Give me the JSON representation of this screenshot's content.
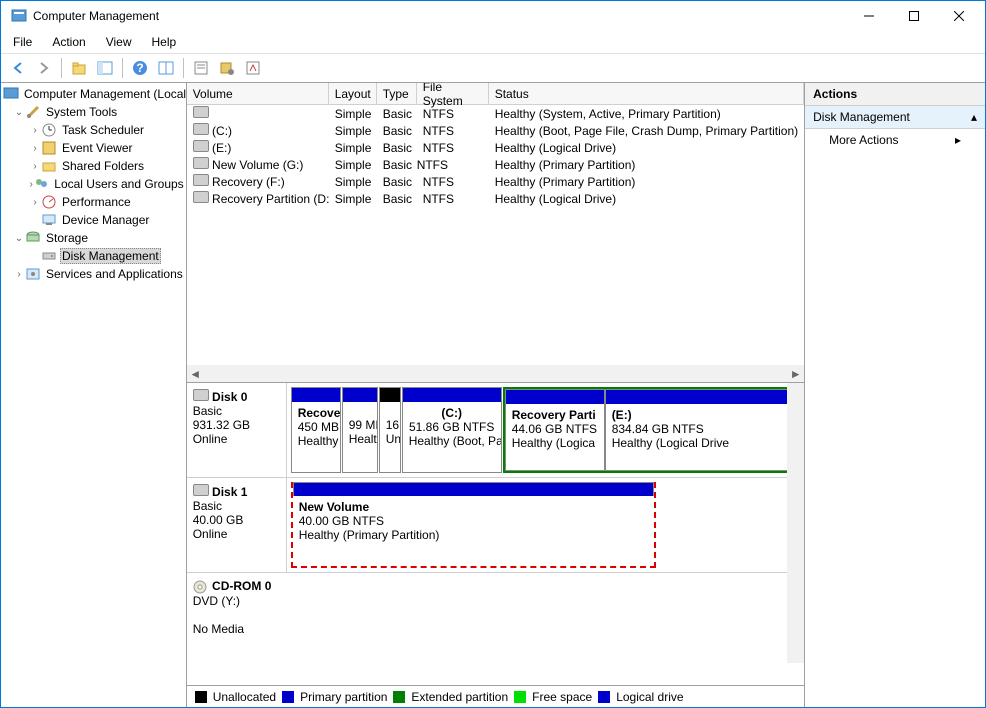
{
  "window": {
    "title": "Computer Management"
  },
  "menu": {
    "file": "File",
    "action": "Action",
    "view": "View",
    "help": "Help"
  },
  "tree": {
    "root": "Computer Management (Local",
    "systemTools": "System Tools",
    "taskScheduler": "Task Scheduler",
    "eventViewer": "Event Viewer",
    "sharedFolders": "Shared Folders",
    "localUsers": "Local Users and Groups",
    "performance": "Performance",
    "deviceManager": "Device Manager",
    "storage": "Storage",
    "diskManagement": "Disk Management",
    "services": "Services and Applications"
  },
  "columns": {
    "volume": "Volume",
    "layout": "Layout",
    "type": "Type",
    "fs": "File System",
    "status": "Status"
  },
  "volumes": [
    {
      "name": "",
      "layout": "Simple",
      "type": "Basic",
      "fs": "NTFS",
      "status": "Healthy (System, Active, Primary Partition)"
    },
    {
      "name": "(C:)",
      "layout": "Simple",
      "type": "Basic",
      "fs": "NTFS",
      "status": "Healthy (Boot, Page File, Crash Dump, Primary Partition)"
    },
    {
      "name": "(E:)",
      "layout": "Simple",
      "type": "Basic",
      "fs": "NTFS",
      "status": "Healthy (Logical Drive)"
    },
    {
      "name": "New Volume (G:)",
      "layout": "Simple",
      "type": "Basic",
      "fs": "NTFS",
      "status": "Healthy (Primary Partition)"
    },
    {
      "name": "Recovery (F:)",
      "layout": "Simple",
      "type": "Basic",
      "fs": "NTFS",
      "status": "Healthy (Primary Partition)"
    },
    {
      "name": "Recovery Partition (D:)",
      "layout": "Simple",
      "type": "Basic",
      "fs": "NTFS",
      "status": "Healthy (Logical Drive)"
    }
  ],
  "disk0": {
    "name": "Disk 0",
    "type": "Basic",
    "size": "931.32 GB",
    "state": "Online",
    "p1": {
      "name": "Recove",
      "size": "450 MB",
      "status": "Healthy"
    },
    "p2": {
      "size": "99 MI",
      "status": "Healt"
    },
    "p3": {
      "size": "16",
      "status": "Un"
    },
    "p4": {
      "name": "(C:)",
      "size": "51.86 GB NTFS",
      "status": "Healthy (Boot, Pa"
    },
    "p5": {
      "name": "Recovery Parti",
      "size": "44.06 GB NTFS",
      "status": "Healthy (Logica"
    },
    "p6": {
      "name": "(E:)",
      "size": "834.84 GB NTFS",
      "status": "Healthy (Logical Drive"
    }
  },
  "disk1": {
    "name": "Disk 1",
    "type": "Basic",
    "size": "40.00 GB",
    "state": "Online",
    "p1": {
      "name": "New Volume",
      "size": "40.00 GB NTFS",
      "status": "Healthy (Primary Partition)"
    }
  },
  "cdrom": {
    "name": "CD-ROM 0",
    "label": "DVD (Y:)",
    "state": "No Media"
  },
  "legend": {
    "unallocated": "Unallocated",
    "primary": "Primary partition",
    "extended": "Extended partition",
    "free": "Free space",
    "logical": "Logical drive"
  },
  "actions": {
    "header": "Actions",
    "dm": "Disk Management",
    "more": "More Actions"
  }
}
